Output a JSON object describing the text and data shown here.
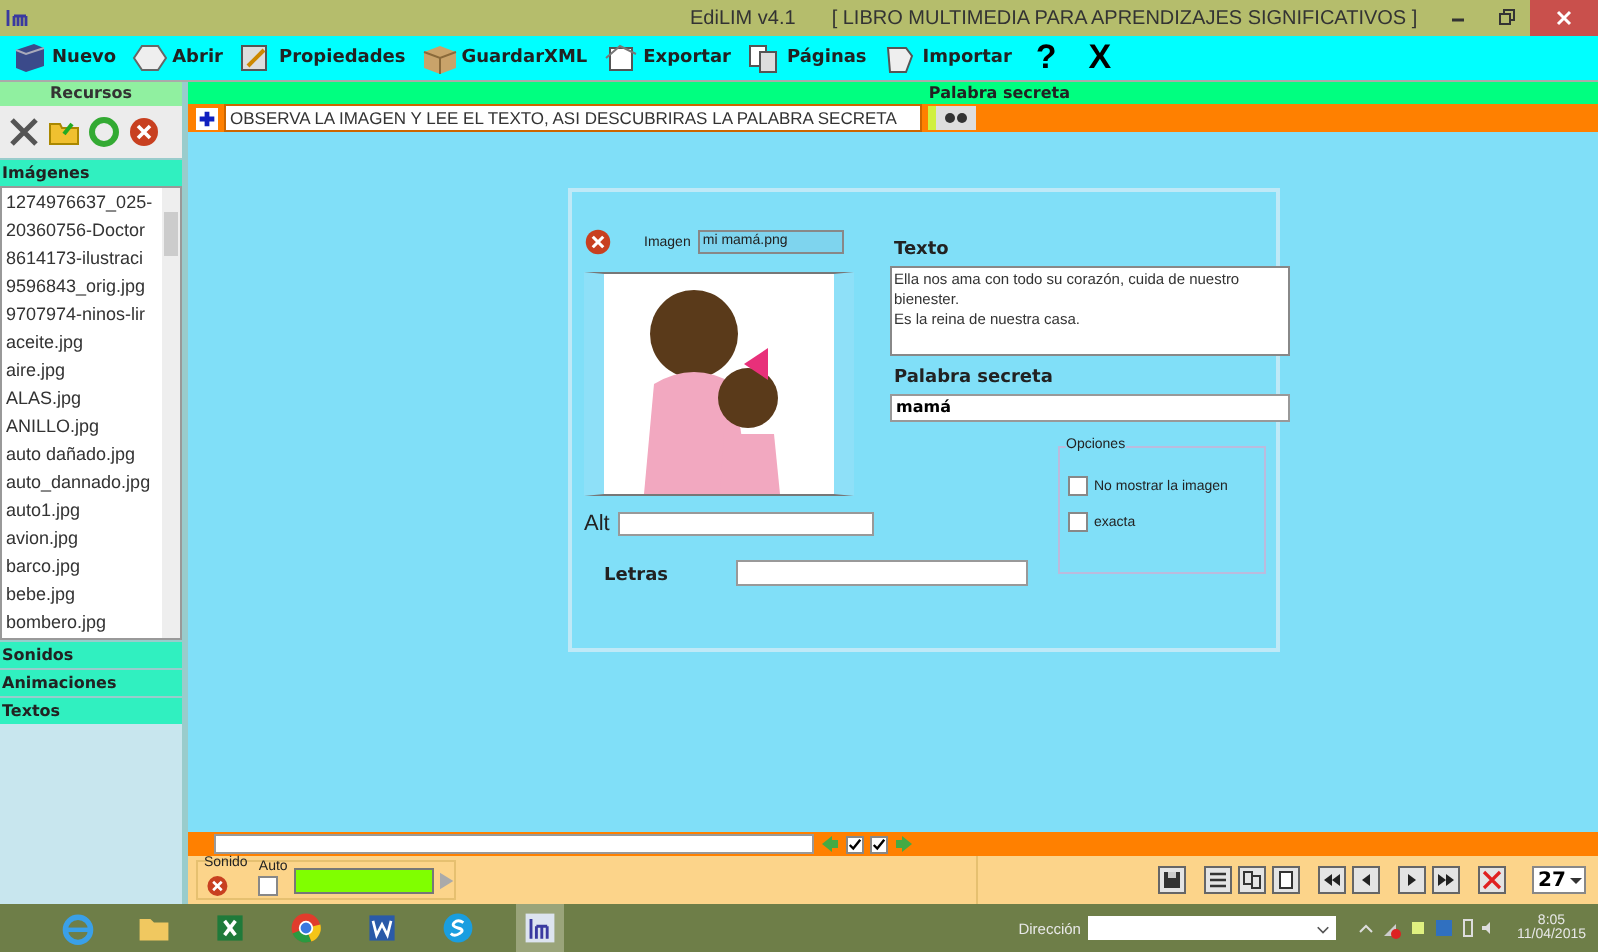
{
  "window": {
    "app_title": "EdiLIM  v4.1",
    "book_title": "[ LIBRO MULTIMEDIA PARA APRENDIZAJES SIGNIFICATIVOS ]"
  },
  "toolbar": [
    {
      "label": "Nuevo",
      "kind": "button"
    },
    {
      "label": "Abrir",
      "kind": "button"
    },
    {
      "label": "Propiedades",
      "kind": "button"
    },
    {
      "label": "GuardarXML",
      "kind": "button"
    },
    {
      "label": "Exportar",
      "kind": "button"
    },
    {
      "label": "Páginas",
      "kind": "button"
    },
    {
      "label": "Importar",
      "kind": "button"
    },
    {
      "label": "?",
      "kind": "glyph"
    },
    {
      "label": "X",
      "kind": "glyph"
    }
  ],
  "sidebar": {
    "title": "Recursos",
    "sections": [
      {
        "label": "Imágenes",
        "items": [
          "1274976637_025-",
          "20360756-Doctor",
          "8614173-ilustraci",
          "9596843_orig.jpg",
          "9707974-ninos-lir",
          "aceite.jpg",
          "aire.jpg",
          "ALAS.jpg",
          "ANILLO.jpg",
          "auto dañado.jpg",
          "auto_dannado.jpg",
          "auto1.jpg",
          "avion.jpg",
          "barco.jpg",
          "bebe.jpg",
          "bombero.jpg"
        ]
      },
      {
        "label": "Sonidos"
      },
      {
        "label": "Animaciones"
      },
      {
        "label": "Textos"
      }
    ]
  },
  "page": {
    "title": "Palabra secreta",
    "instruction": "OBSERVA LA IMAGEN Y LEE EL TEXTO, ASI DESCUBRIRAS LA PALABRA SECRETA",
    "image_label": "Imagen",
    "image_file": "mi mamá.png",
    "text_label": "Texto",
    "text_value": "Ella nos ama con todo su corazón, cuida de nuestro bienester.\nEs la reina de nuestra casa.",
    "secret_label": "Palabra secreta",
    "secret_value": "mamá",
    "alt_label": "Alt",
    "letters_label": "Letras",
    "options": {
      "title": "Opciones",
      "items": [
        {
          "label": "No mostrar la imagen",
          "checked": false
        },
        {
          "label": "exacta",
          "checked": false
        }
      ]
    }
  },
  "bottom": {
    "nav_checks": [
      {
        "checked": true
      },
      {
        "checked": true
      }
    ],
    "sound_label": "Sonido",
    "auto_label": "Auto",
    "auto_checked": false,
    "page_number": "27"
  },
  "taskbar": {
    "address_label": "Dirección",
    "time": "8:05",
    "date": "11/04/2015"
  }
}
